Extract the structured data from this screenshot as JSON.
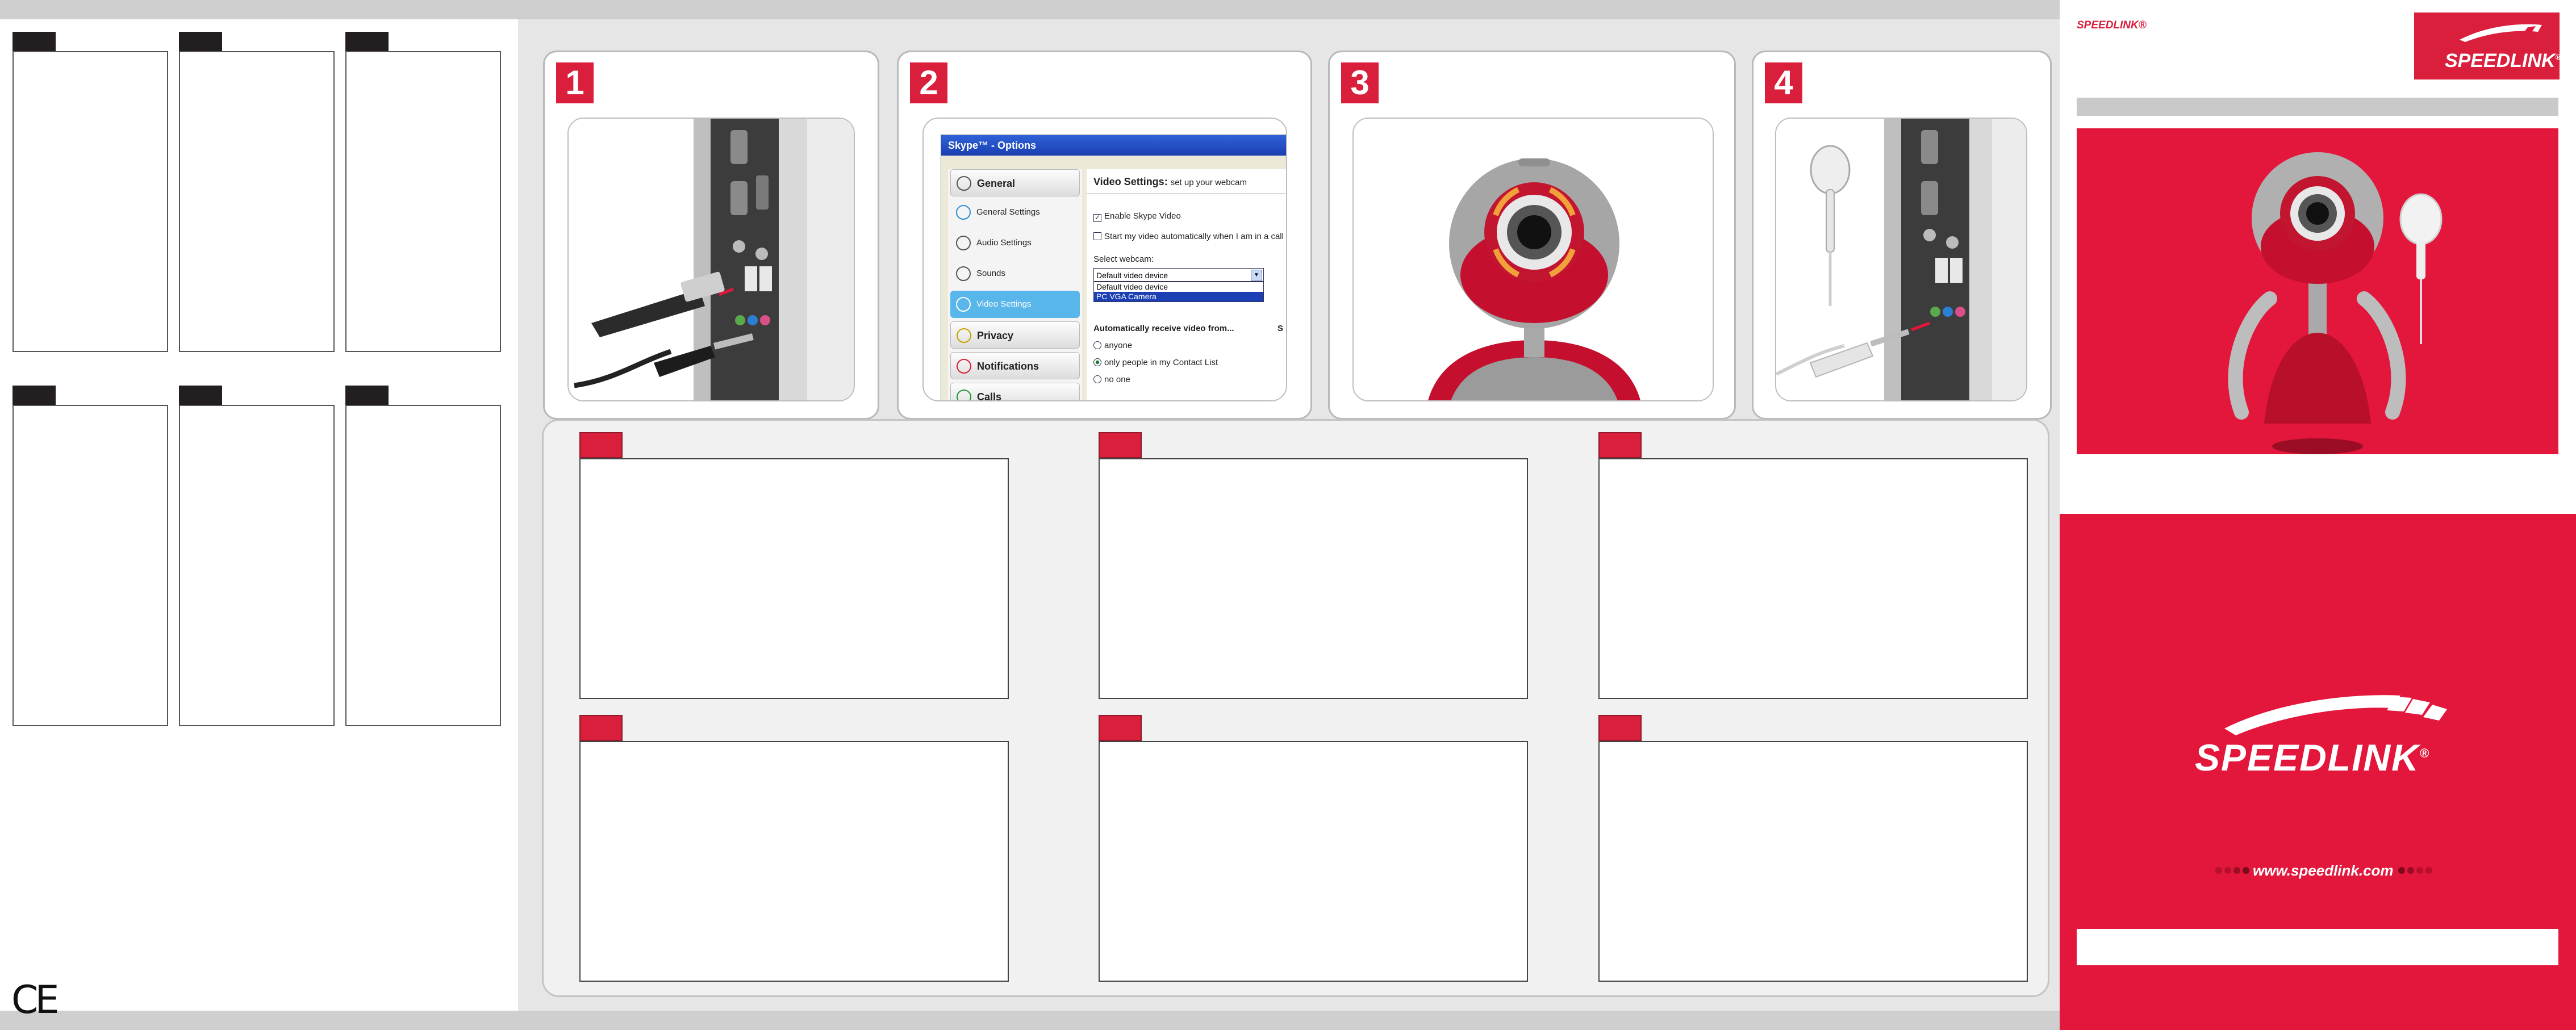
{
  "steps": [
    {
      "number": "1"
    },
    {
      "number": "2"
    },
    {
      "number": "3"
    },
    {
      "number": "4"
    }
  ],
  "skype": {
    "window_title": "Skype™ - Options",
    "sidebar": [
      {
        "label": "General",
        "style": "section"
      },
      {
        "label": "General Settings",
        "style": "item"
      },
      {
        "label": "Audio Settings",
        "style": "item"
      },
      {
        "label": "Sounds",
        "style": "item"
      },
      {
        "label": "Video Settings",
        "style": "selected"
      },
      {
        "label": "Privacy",
        "style": "section"
      },
      {
        "label": "Notifications",
        "style": "section"
      },
      {
        "label": "Calls",
        "style": "section"
      }
    ],
    "heading": "Video Settings:",
    "heading_sub": "set up your webcam",
    "enable_video": "Enable Skype Video",
    "start_video": "Start my video automatically when I am in a call",
    "select_webcam_label": "Select webcam:",
    "webcam_selected": "Default video device",
    "webcam_options": [
      "Default video device",
      "PC VGA Camera"
    ],
    "receive_label": "Automatically receive video from...",
    "receive_options": [
      "anyone",
      "only people in my Contact List",
      "no one"
    ],
    "cut_char": "S"
  },
  "brand": {
    "small_logo": "SPEEDLINK®",
    "logo": "SPEEDLINK",
    "logo_reg": "®",
    "url": "www.speedlink.com"
  },
  "ce_mark": "CE",
  "colors": {
    "brand_red": "#e3163c",
    "dark_tab": "#231f20",
    "panel_grey": "#e6e6e6"
  }
}
